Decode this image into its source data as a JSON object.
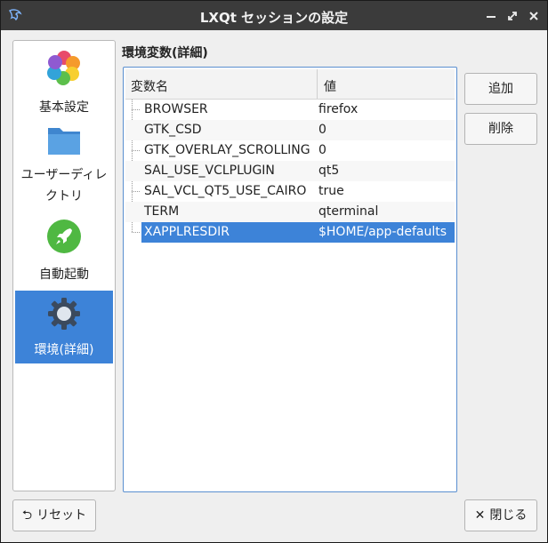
{
  "window": {
    "title": "LXQt セッションの設定",
    "colors": {
      "titlebar": "#3b3b3b",
      "accent": "#3d83d8"
    }
  },
  "sidebar": {
    "items": [
      {
        "label": "基本設定",
        "icon": "flower-icon",
        "selected": false
      },
      {
        "label": "ユーザーディレ",
        "label2": "クトリ",
        "icon": "folder-icon",
        "selected": false
      },
      {
        "label": "自動起動",
        "icon": "rocket-icon",
        "selected": false
      },
      {
        "label": "環境(詳細)",
        "icon": "gear-icon",
        "selected": true
      }
    ]
  },
  "main": {
    "section_title": "環境変数(詳細)",
    "columns": [
      "変数名",
      "値"
    ],
    "rows": [
      {
        "name": "BROWSER",
        "value": "firefox"
      },
      {
        "name": "GTK_CSD",
        "value": "0"
      },
      {
        "name": "GTK_OVERLAY_SCROLLING",
        "value": "0"
      },
      {
        "name": "SAL_USE_VCLPLUGIN",
        "value": "qt5"
      },
      {
        "name": "SAL_VCL_QT5_USE_CAIRO",
        "value": "true"
      },
      {
        "name": "TERM",
        "value": "qterminal"
      },
      {
        "name": "XAPPLRESDIR",
        "value": "$HOME/app-defaults",
        "selected": true
      }
    ]
  },
  "actions": {
    "add": "追加",
    "delete": "削除"
  },
  "footer": {
    "reset": "リセット",
    "reset_icon": "undo-icon",
    "close": "閉じる",
    "close_icon": "close-icon"
  }
}
